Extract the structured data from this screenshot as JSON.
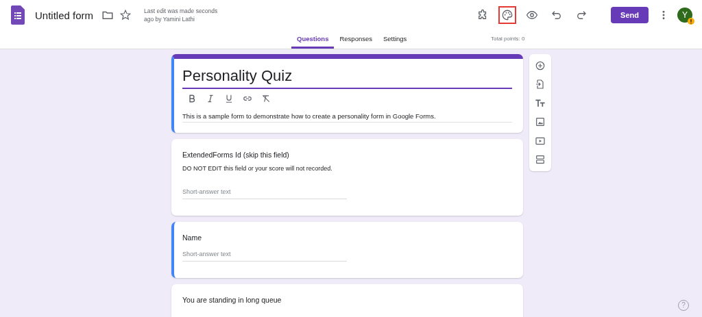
{
  "header": {
    "title": "Untitled form",
    "last_edit": "Last edit was made seconds ago by Yamini Lathi",
    "actions": [
      {
        "kind": "addons",
        "highlighted": false
      },
      {
        "kind": "palette",
        "highlighted": true
      },
      {
        "kind": "preview",
        "highlighted": false
      },
      {
        "kind": "undo",
        "highlighted": false
      },
      {
        "kind": "redo",
        "highlighted": false
      }
    ],
    "send": "Send",
    "avatar": "Y"
  },
  "tabs": [
    {
      "label": "Questions",
      "selected": true
    },
    {
      "label": "Responses",
      "selected": false
    },
    {
      "label": "Settings",
      "selected": false
    }
  ],
  "total_points": "Total points: 0",
  "form": {
    "title": "Personality Quiz",
    "description": "This is a sample form to demonstrate how to create a personality form in Google Forms.",
    "selected": true
  },
  "questions": [
    {
      "title": "ExtendedForms Id (skip this field)",
      "description": "DO NOT EDIT this field or your score will not recorded.",
      "placeholder": "Short-answer text",
      "selected": false
    },
    {
      "title": "Name",
      "placeholder": "Short-answer text",
      "selected": true
    },
    {
      "title": "You are standing in long queue",
      "selected": false
    }
  ],
  "help": "?"
}
